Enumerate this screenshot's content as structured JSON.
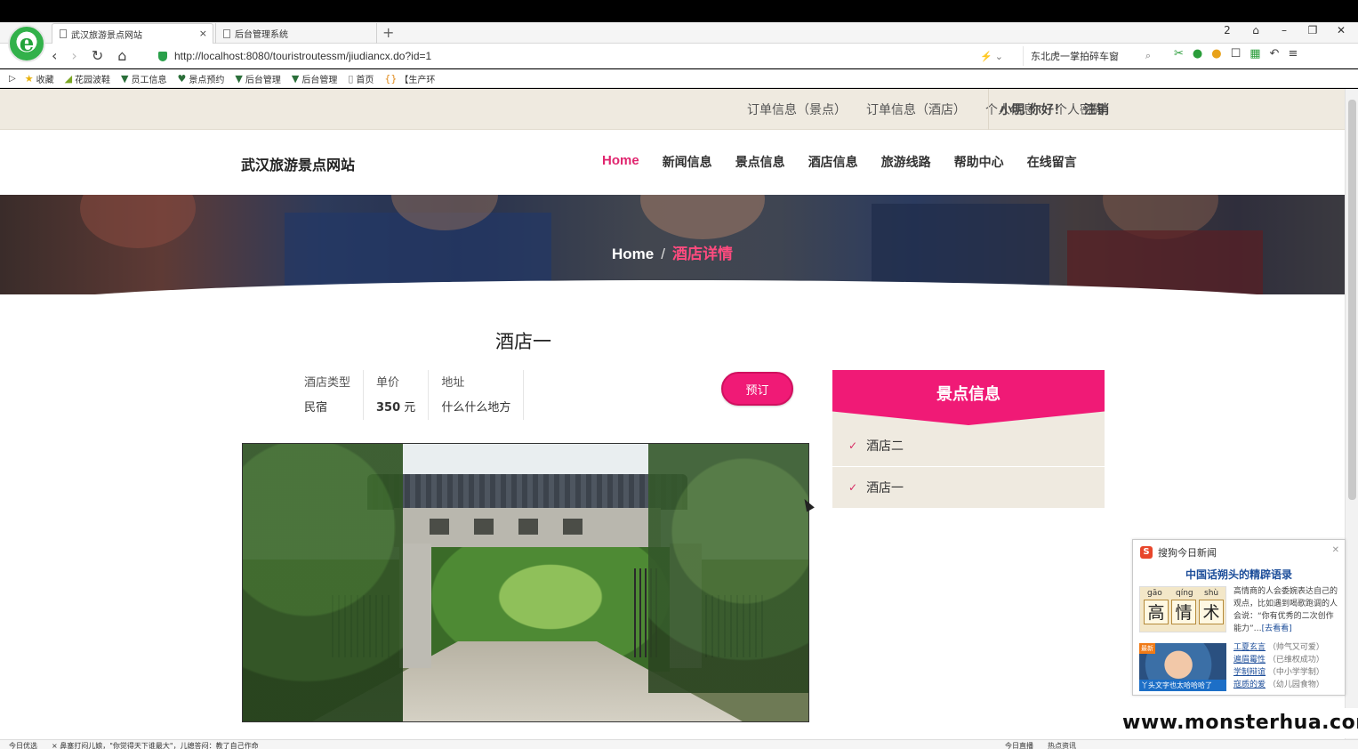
{
  "browser": {
    "tabs": [
      {
        "label": "武汉旅游景点网站",
        "close": "×"
      },
      {
        "label": "后台管理系统"
      }
    ],
    "new_tab": "+",
    "url": "http://localhost:8080/touristroutessm/jiudiancx.do?id=1",
    "search_text": "东北虎一掌拍碎车窗",
    "window_controls": [
      "2",
      "⌂",
      "–",
      "❐",
      "✕"
    ],
    "favorites": [
      {
        "icon": "star-icon",
        "label": "收藏"
      },
      {
        "icon": "leaf-icon",
        "label": "花园波鞋"
      },
      {
        "icon": "v-icon",
        "label": "员工信息"
      },
      {
        "icon": "pin-icon",
        "label": "景点预约"
      },
      {
        "icon": "v-icon",
        "label": "后台管理"
      },
      {
        "icon": "v-icon",
        "label": "后台管理"
      },
      {
        "icon": "doc-icon",
        "label": "首页"
      },
      {
        "icon": "bracket-icon",
        "label": "【生产环"
      }
    ]
  },
  "topinfo": {
    "links": [
      "订单信息（景点）",
      "订单信息（酒店）",
      "个人信息",
      "个人密码"
    ],
    "greeting": "小明 你好！",
    "logout": "注销"
  },
  "header": {
    "site_title": "武汉旅游景点网站",
    "nav": [
      "Home",
      "新闻信息",
      "景点信息",
      "酒店信息",
      "旅游线路",
      "帮助中心",
      "在线留言"
    ]
  },
  "breadcrumb": {
    "home": "Home",
    "sep": "/",
    "current": "酒店详情"
  },
  "hotel": {
    "name": "酒店一",
    "type_label": "酒店类型",
    "type_value": "民宿",
    "price_label": "单价",
    "price_value": "350",
    "price_unit": "元",
    "address_label": "地址",
    "address_value": "什么什么地方",
    "book_button": "预订"
  },
  "sidebar": {
    "title": "景点信息",
    "items": [
      "酒店二",
      "酒店一"
    ]
  },
  "news_popup": {
    "source": "搜狗今日新闻",
    "headline": "中国话朔头的精辟语录",
    "pinyin": [
      "gāo",
      "qíng",
      "shù"
    ],
    "chars": [
      "高",
      "情",
      "术"
    ],
    "summary": "高情商的人会委婉表达自己的观点，比如遇到喝歌跑调的人会说：“你有优秀的二次创作能力”…",
    "more": "[去看看]",
    "thumb_tag": "最新",
    "thumb_caption": "丫头文字也太哈哈哈了",
    "links": [
      {
        "title": "工夏玄言",
        "note": "（帅气又可爱）"
      },
      {
        "title": "遍眉霉性",
        "note": "（已维权成功）"
      },
      {
        "title": "学制辩谊",
        "note": "（中小学学制）"
      },
      {
        "title": "寇质的爱",
        "note": "（幼儿园食物）"
      }
    ]
  },
  "statusbar": {
    "left": "今日优选　　× 鼻塞打闷儿娘，\"你觉得天下谁最大\"，儿媳答闷：教了自己作命",
    "right": "今日直播　　热点资讯"
  },
  "watermark": "www.monsterhua.com"
}
